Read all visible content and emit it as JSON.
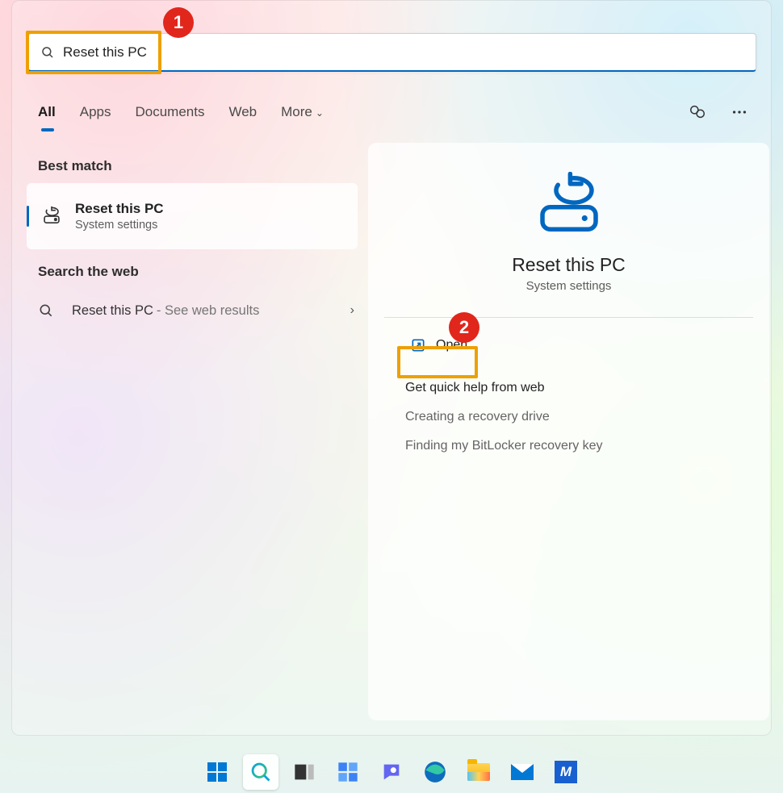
{
  "annotations": {
    "callout1": "1",
    "callout2": "2"
  },
  "search": {
    "value": "Reset this PC"
  },
  "tabs": {
    "all": "All",
    "apps": "Apps",
    "documents": "Documents",
    "web": "Web",
    "more": "More"
  },
  "sections": {
    "best_match": "Best match",
    "search_web": "Search the web"
  },
  "best_match_item": {
    "title": "Reset this PC",
    "subtitle": "System settings"
  },
  "web_item": {
    "label": "Reset this PC",
    "suffix": " - See web results"
  },
  "detail": {
    "title": "Reset this PC",
    "subtitle": "System settings",
    "open": "Open",
    "help_header": "Get quick help from web",
    "help_links": [
      "Creating a recovery drive",
      "Finding my BitLocker recovery key"
    ]
  }
}
